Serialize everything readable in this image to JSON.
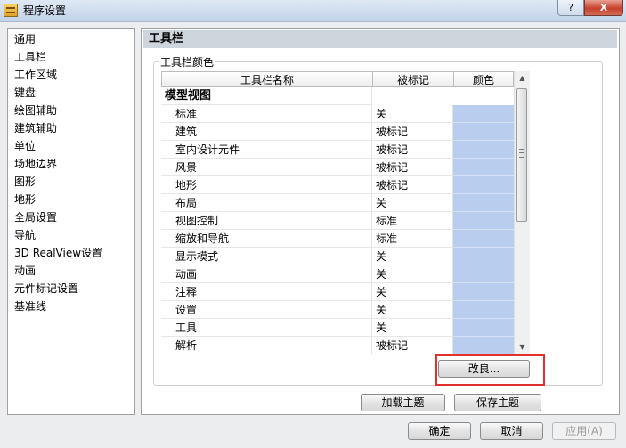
{
  "window": {
    "title": "程序设置",
    "help_label": "?",
    "close_label": "X"
  },
  "nav": {
    "items": [
      "通用",
      "工具栏",
      "工作区域",
      "键盘",
      "绘图辅助",
      "建筑辅助",
      "单位",
      "场地边界",
      "图形",
      "地形",
      "全局设置",
      "导航",
      "3D RealView设置",
      "动画",
      "元件标记设置",
      "基准线"
    ]
  },
  "section": {
    "title": "工具栏",
    "group_title": "工具栏颜色",
    "columns": {
      "name": "工具栏名称",
      "flag": "被标记",
      "color": "颜色"
    },
    "group_name": "模型视图",
    "rows": [
      {
        "name": "标准",
        "flag": "关"
      },
      {
        "name": "建筑",
        "flag": "被标记"
      },
      {
        "name": "室内设计元件",
        "flag": "被标记"
      },
      {
        "name": "风景",
        "flag": "被标记"
      },
      {
        "name": "地形",
        "flag": "被标记"
      },
      {
        "name": "布局",
        "flag": "关"
      },
      {
        "name": "视图控制",
        "flag": "标准"
      },
      {
        "name": "缩放和导航",
        "flag": "标准"
      },
      {
        "name": "显示模式",
        "flag": "关"
      },
      {
        "name": "动画",
        "flag": "关"
      },
      {
        "name": "注释",
        "flag": "关"
      },
      {
        "name": "设置",
        "flag": "关"
      },
      {
        "name": "工具",
        "flag": "关"
      },
      {
        "name": "解析",
        "flag": "被标记"
      }
    ],
    "color_swatch": "#b9cdee",
    "modify_label": "改良...",
    "load_theme_label": "加载主题",
    "save_theme_label": "保存主题"
  },
  "footer": {
    "ok_label": "确定",
    "cancel_label": "取消",
    "apply_label": "应用(A)"
  },
  "colors": {
    "highlight": "#e0312c",
    "header_bg": "#cfd5dd"
  },
  "icons": {
    "scroll_up": "▲",
    "scroll_down": "▼"
  }
}
